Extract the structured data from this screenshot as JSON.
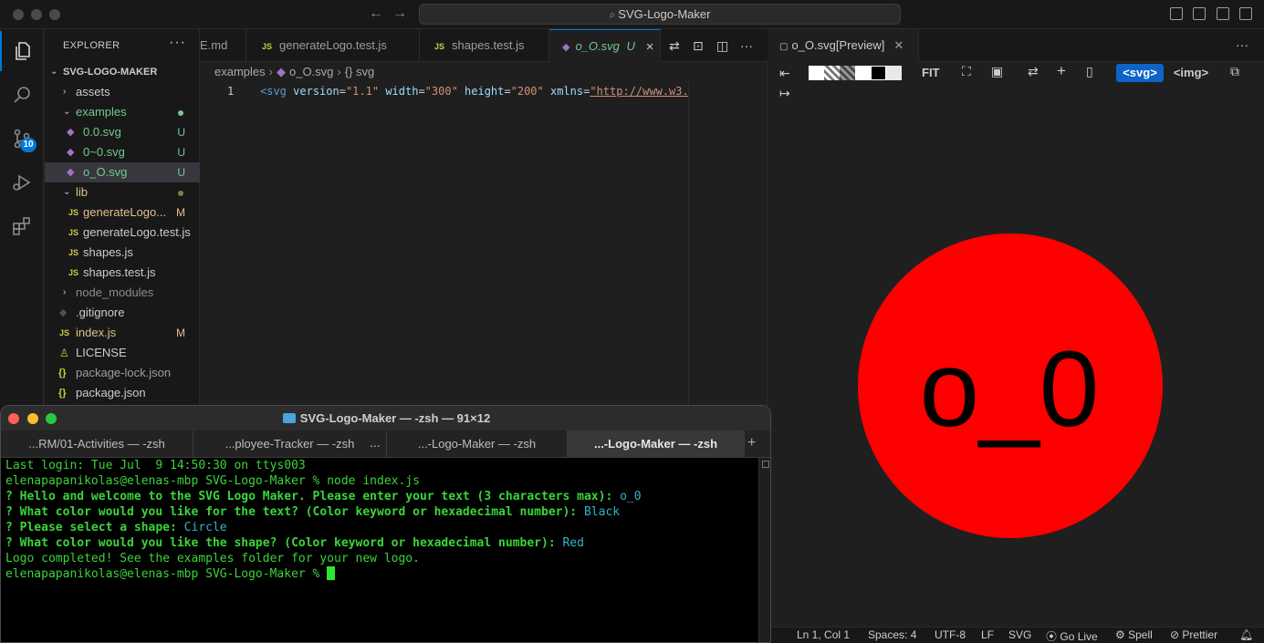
{
  "window": {
    "search_text": "SVG-Logo-Maker"
  },
  "activity_bar": {
    "scm_badge": "10"
  },
  "explorer": {
    "header": "EXPLORER",
    "more": "···",
    "root": "SVG-LOGO-MAKER",
    "items": [
      {
        "label": "assets",
        "status": ""
      },
      {
        "label": "examples",
        "status": ""
      },
      {
        "label": "0.0.svg",
        "status": "U"
      },
      {
        "label": "0~0.svg",
        "status": "U"
      },
      {
        "label": "o_O.svg",
        "status": "U"
      },
      {
        "label": "lib",
        "status": ""
      },
      {
        "label": "generateLogo...",
        "status": "M"
      },
      {
        "label": "generateLogo.test.js",
        "status": ""
      },
      {
        "label": "shapes.js",
        "status": ""
      },
      {
        "label": "shapes.test.js",
        "status": ""
      },
      {
        "label": "node_modules",
        "status": ""
      },
      {
        "label": ".gitignore",
        "status": ""
      },
      {
        "label": "index.js",
        "status": "M"
      },
      {
        "label": "LICENSE",
        "status": ""
      },
      {
        "label": "package-lock.json",
        "status": ""
      },
      {
        "label": "package.json",
        "status": ""
      }
    ]
  },
  "editor": {
    "tabs": [
      {
        "label": "E.md"
      },
      {
        "label": "generateLogo.test.js",
        "icon": "JS"
      },
      {
        "label": "shapes.test.js",
        "icon": "JS"
      },
      {
        "label": "o_O.svg",
        "status": "U",
        "close": "✕"
      }
    ],
    "breadcrumb": [
      "examples",
      "o_O.svg",
      "{} svg"
    ],
    "line_number": "1",
    "code": {
      "open": "<svg",
      "attr1": "version",
      "val1": "\"1.1\"",
      "attr2": "width",
      "val2": "\"300\"",
      "attr3": "height",
      "val3": "\"200\"",
      "attr4": "xmlns",
      "val4": "\"http://www.w3."
    }
  },
  "preview": {
    "tab_label": "o_O.svg[Preview]",
    "close": "✕",
    "more": "···",
    "fit": "FIT",
    "svg_button": "<svg>",
    "img_button": "<img>",
    "logo": {
      "text": "o_0",
      "fill": "#ff0000",
      "text_color": "#000000"
    }
  },
  "statusbar": {
    "position": "Ln 1, Col 1",
    "spaces": "Spaces: 4",
    "encoding": "UTF-8",
    "eol": "LF",
    "language": "SVG",
    "golive": "Go Live",
    "spell": "Spell",
    "prettier": "Prettier"
  },
  "terminal": {
    "title": "SVG-Logo-Maker — -zsh — 91×12",
    "tabs": [
      {
        "label": "...RM/01-Activities — -zsh"
      },
      {
        "label": "...ployee-Tracker — -zsh"
      },
      {
        "label": "...-Logo-Maker — -zsh"
      },
      {
        "label": "...-Logo-Maker — -zsh"
      }
    ],
    "tab_more": "...",
    "new_tab": "+",
    "lines": {
      "login": "Last login: Tue Jul  9 14:50:30 on ttys003",
      "cmd_prompt": "elenapapanikolas@elenas-mbp SVG-Logo-Maker % ",
      "cmd": "node index.js",
      "q1": "? Hello and welcome to the SVG Logo Maker. Please enter your text (3 characters max): ",
      "a1": "o_0",
      "q2": "? What color would you like for the text? (Color keyword or hexadecimal number): ",
      "a2": "Black",
      "q3": "? Please select a shape: ",
      "a3": "Circle",
      "q4": "? What color would you like the shape? (Color keyword or hexadecimal number): ",
      "a4": "Red",
      "done": "Logo completed! See the examples folder for your new logo.",
      "prompt": "elenapapanikolas@elenas-mbp SVG-Logo-Maker % "
    }
  }
}
